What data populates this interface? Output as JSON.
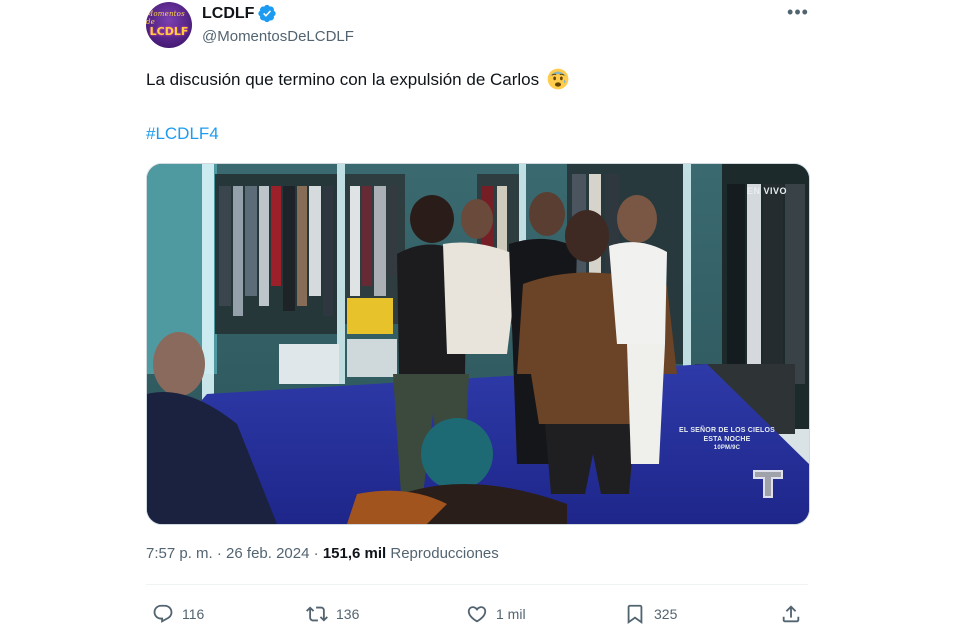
{
  "author": {
    "display_name": "LCDLF",
    "handle": "@MomentosDeLCDLF",
    "avatar_text_top": "Momentos de",
    "avatar_text_main": "LCDLF"
  },
  "tweet": {
    "text": "La discusión que termino con la expulsión de Carlos",
    "emoji": "anxious-face-with-sweat",
    "hashtag": "#LCDLF4"
  },
  "media": {
    "overlay_live": "EN VIVO",
    "promo_line1": "EL SEÑOR DE LOS CIELOS",
    "promo_line2": "ESTA NOCHE",
    "promo_line3": "10PM/9C",
    "network_logo": "telemundo-t-logo"
  },
  "meta": {
    "time": "7:57 p. m.",
    "separator": "·",
    "date": "26 feb. 2024",
    "views_count": "151,6 mil",
    "views_label": "Reproducciones"
  },
  "actions": {
    "replies": "116",
    "reposts": "136",
    "likes": "1 mil",
    "bookmarks": "325"
  },
  "colors": {
    "link": "#1d9bf0",
    "secondary_text": "#536471",
    "primary_text": "#0f1419",
    "verified": "#1d9bf0"
  }
}
